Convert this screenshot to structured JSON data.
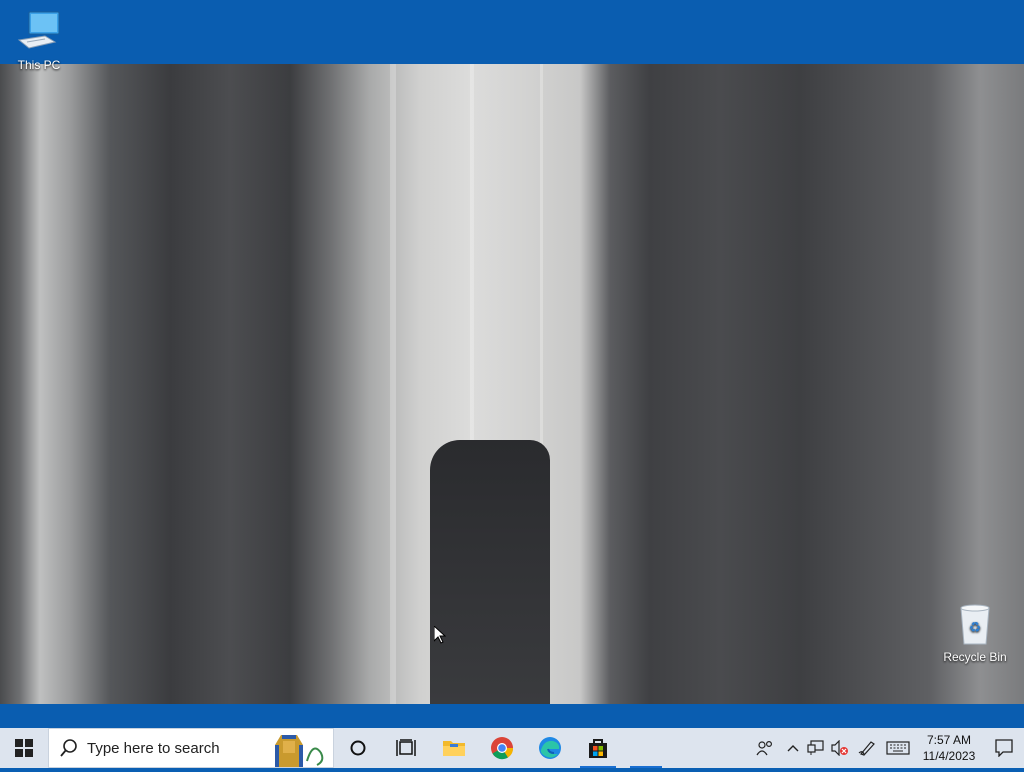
{
  "desktop": {
    "icons": [
      {
        "label": "This PC"
      },
      {
        "label": "Recycle Bin"
      }
    ]
  },
  "taskbar": {
    "search_placeholder": "Type here to search",
    "apps": [
      "start",
      "search-highlight",
      "cortana",
      "task-view",
      "file-explorer",
      "chrome",
      "edge",
      "microsoft-store"
    ],
    "clock": {
      "time": "7:57 AM",
      "date": "11/4/2023"
    },
    "accent": "#1a6fd1"
  }
}
